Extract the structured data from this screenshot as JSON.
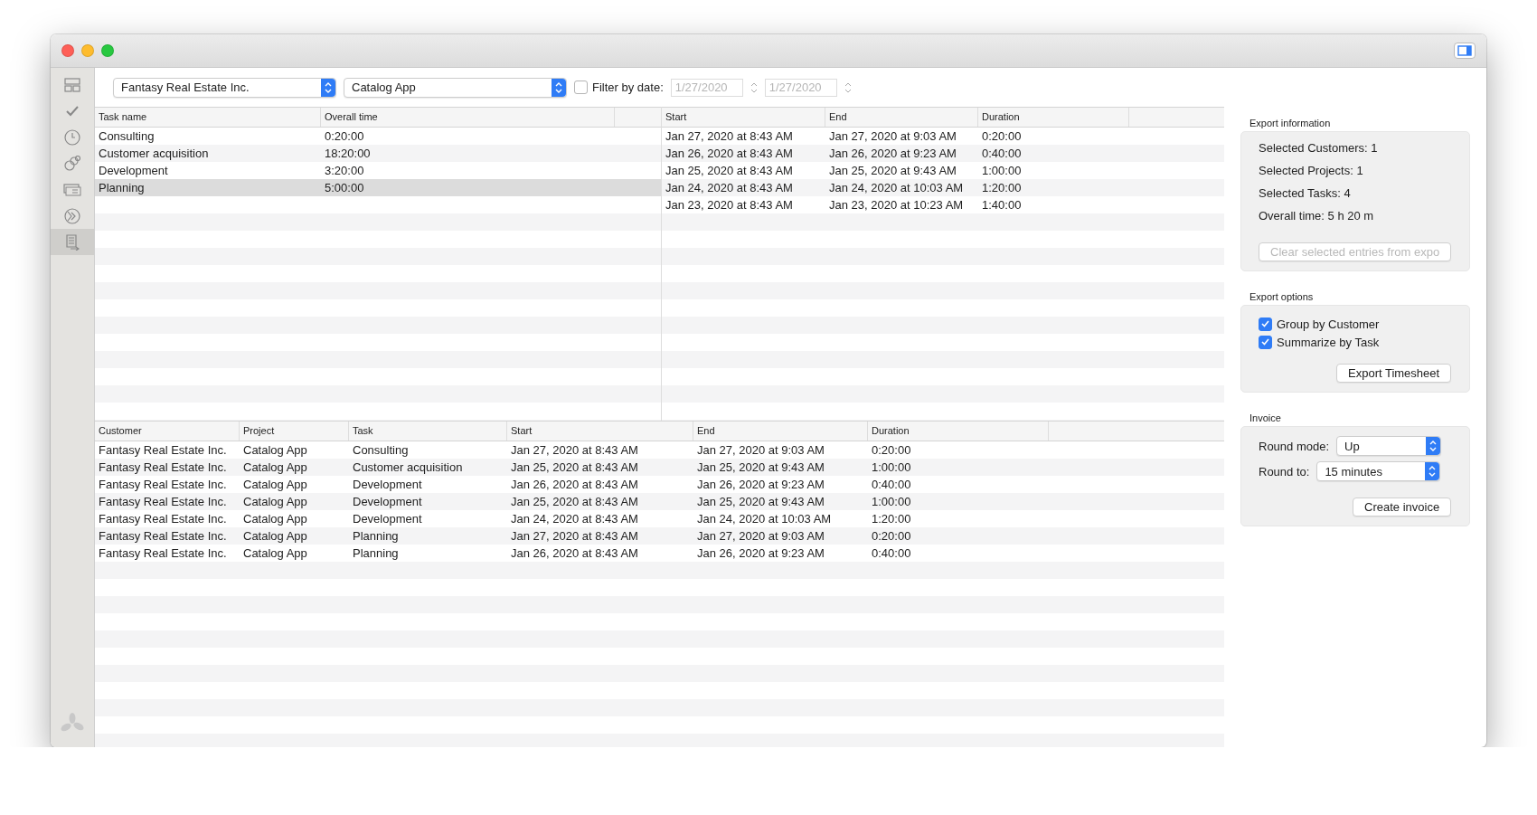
{
  "sidebar": {
    "items": [
      {
        "kind": "layout",
        "selected": false
      },
      {
        "kind": "check",
        "selected": false
      },
      {
        "kind": "clock",
        "selected": false
      },
      {
        "kind": "people",
        "selected": false
      },
      {
        "kind": "money",
        "selected": false
      },
      {
        "kind": "globe",
        "selected": false
      },
      {
        "kind": "report",
        "selected": true
      }
    ]
  },
  "toolbar": {
    "customer_select": {
      "value": "Fantasy Real Estate Inc."
    },
    "project_select": {
      "value": "Catalog App"
    },
    "filter": {
      "label": "Filter by date:",
      "checked": false
    },
    "date_from": {
      "value": "1/27/2020",
      "disabled": true
    },
    "date_to": {
      "value": "1/27/2020",
      "disabled": true
    }
  },
  "tasks_table": {
    "columns": [
      "Task name",
      "Overall time"
    ],
    "rows": [
      {
        "cells": [
          "Consulting",
          "0:20:00"
        ],
        "selected": false
      },
      {
        "cells": [
          "Customer acquisition",
          "18:20:00"
        ],
        "selected": false
      },
      {
        "cells": [
          "Development",
          "3:20:00"
        ],
        "selected": false
      },
      {
        "cells": [
          "Planning",
          "5:00:00"
        ],
        "selected": true
      }
    ]
  },
  "times_table": {
    "columns": [
      "Start",
      "End",
      "Duration"
    ],
    "rows": [
      [
        "Jan 27, 2020 at 8:43 AM",
        "Jan 27, 2020 at 9:03 AM",
        "0:20:00"
      ],
      [
        "Jan 26, 2020 at 8:43 AM",
        "Jan 26, 2020 at 9:23 AM",
        "0:40:00"
      ],
      [
        "Jan 25, 2020 at 8:43 AM",
        "Jan 25, 2020 at 9:43 AM",
        "1:00:00"
      ],
      [
        "Jan 24, 2020 at 8:43 AM",
        "Jan 24, 2020 at 10:03 AM",
        "1:20:00"
      ],
      [
        "Jan 23, 2020 at 8:43 AM",
        "Jan 23, 2020 at 10:23 AM",
        "1:40:00"
      ]
    ]
  },
  "entries_table": {
    "columns": [
      "Customer",
      "Project",
      "Task",
      "Start",
      "End",
      "Duration"
    ],
    "rows": [
      [
        "Fantasy Real Estate Inc.",
        "Catalog App",
        "Consulting",
        "Jan 27, 2020 at 8:43 AM",
        "Jan 27, 2020 at 9:03 AM",
        "0:20:00"
      ],
      [
        "Fantasy Real Estate Inc.",
        "Catalog App",
        "Customer acquisition",
        "Jan 25, 2020 at 8:43 AM",
        "Jan 25, 2020 at 9:43 AM",
        "1:00:00"
      ],
      [
        "Fantasy Real Estate Inc.",
        "Catalog App",
        "Development",
        "Jan 26, 2020 at 8:43 AM",
        "Jan 26, 2020 at 9:23 AM",
        "0:40:00"
      ],
      [
        "Fantasy Real Estate Inc.",
        "Catalog App",
        "Development",
        "Jan 25, 2020 at 8:43 AM",
        "Jan 25, 2020 at 9:43 AM",
        "1:00:00"
      ],
      [
        "Fantasy Real Estate Inc.",
        "Catalog App",
        "Development",
        "Jan 24, 2020 at 8:43 AM",
        "Jan 24, 2020 at 10:03 AM",
        "1:20:00"
      ],
      [
        "Fantasy Real Estate Inc.",
        "Catalog App",
        "Planning",
        "Jan 27, 2020 at 8:43 AM",
        "Jan 27, 2020 at 9:03 AM",
        "0:20:00"
      ],
      [
        "Fantasy Real Estate Inc.",
        "Catalog App",
        "Planning",
        "Jan 26, 2020 at 8:43 AM",
        "Jan 26, 2020 at 9:23 AM",
        "0:40:00"
      ]
    ]
  },
  "export_information": {
    "title": "Export information",
    "lines": [
      "Selected Customers: 1",
      "Selected Projects: 1",
      "Selected Tasks: 4",
      "Overall time: 5 h 20 m"
    ],
    "clear_button": {
      "label": "Clear selected entries from expo",
      "disabled": true
    }
  },
  "export_options": {
    "title": "Export options",
    "options": [
      {
        "label": "Group by Customer",
        "checked": true
      },
      {
        "label": "Summarize by Task",
        "checked": true
      }
    ],
    "export_button": "Export Timesheet"
  },
  "invoice": {
    "title": "Invoice",
    "round_mode": {
      "label": "Round mode:",
      "value": "Up"
    },
    "round_to": {
      "label": "Round to:",
      "value": "15 minutes"
    },
    "create_button": "Create invoice"
  }
}
